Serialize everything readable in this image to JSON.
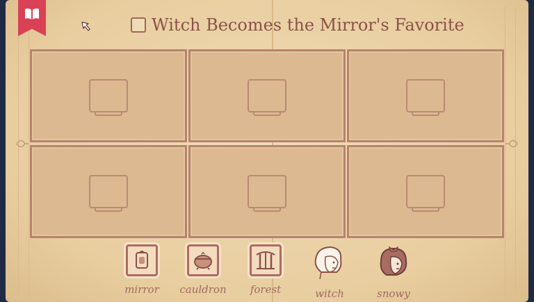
{
  "title": "Witch Becomes the Mirror's Favorite",
  "icons": {
    "bookmark": "book-icon",
    "cursor": "cursor-arrow-icon"
  },
  "panels": [
    {
      "state": "empty"
    },
    {
      "state": "empty"
    },
    {
      "state": "empty"
    },
    {
      "state": "empty"
    },
    {
      "state": "empty"
    },
    {
      "state": "empty"
    }
  ],
  "tray": [
    {
      "label": "mirror",
      "icon": "mirror-icon"
    },
    {
      "label": "cauldron",
      "icon": "cauldron-icon"
    },
    {
      "label": "forest",
      "icon": "forest-icon"
    },
    {
      "label": "witch",
      "icon": "witch-portrait-icon"
    },
    {
      "label": "snowy",
      "icon": "snowy-portrait-icon"
    }
  ],
  "colors": {
    "page": "#ecd3a8",
    "bookmark": "#d94255",
    "ink": "#8a5248",
    "frame": "#b7836f",
    "background": "#1f2b45"
  }
}
